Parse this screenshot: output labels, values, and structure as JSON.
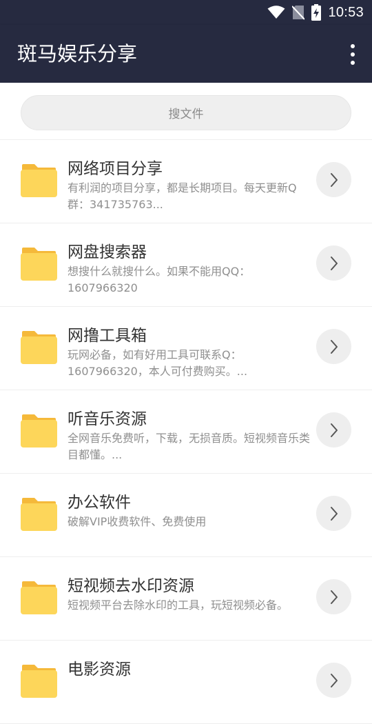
{
  "status_bar": {
    "time": "10:53",
    "icons": [
      "wifi-icon",
      "no-sim-icon",
      "battery-charging-icon"
    ]
  },
  "app_bar": {
    "title": "斑马娱乐分享",
    "menu_icon": "more-vert-icon"
  },
  "search": {
    "placeholder": "搜文件"
  },
  "colors": {
    "app_bar_bg": "#262a40",
    "folder_yellow": "#fdd65a",
    "folder_tab": "#f5b93a",
    "chevron_bg": "#eeeeee"
  },
  "items": [
    {
      "title": "网络项目分享",
      "desc": "有利润的项目分享，都是长期项目。每天更新Q群：341735763..."
    },
    {
      "title": "网盘搜索器",
      "desc": "想搜什么就搜什么。如果不能用QQ：1607966320"
    },
    {
      "title": "网撸工具箱",
      "desc": "玩网必备，如有好用工具可联系Q：1607966320，本人可付费购买。..."
    },
    {
      "title": "听音乐资源",
      "desc": "全网音乐免费听，下载，无损音质。短视频音乐类目都懂。..."
    },
    {
      "title": "办公软件",
      "desc": "破解VIP收费软件、免费使用"
    },
    {
      "title": "短视频去水印资源",
      "desc": "短视频平台去除水印的工具，玩短视频必备。"
    },
    {
      "title": "电影资源",
      "desc": ""
    }
  ]
}
